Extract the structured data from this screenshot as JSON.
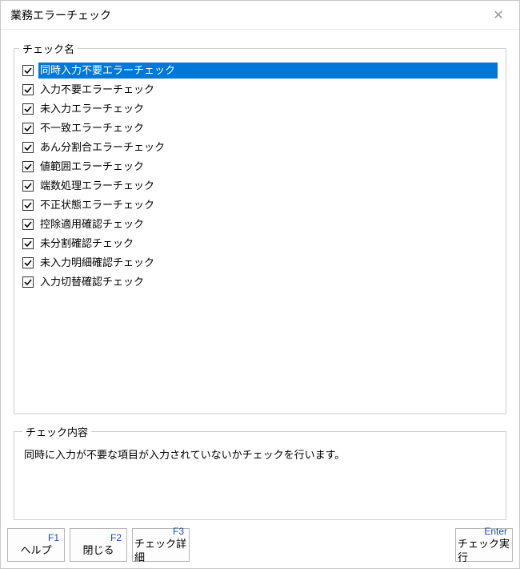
{
  "window": {
    "title": "業務エラーチェック",
    "closeGlyph": "✕"
  },
  "listLegend": "チェック名",
  "items": [
    {
      "label": "同時入力不要エラーチェック",
      "checked": true,
      "selected": true
    },
    {
      "label": "入力不要エラーチェック",
      "checked": true,
      "selected": false
    },
    {
      "label": "未入力エラーチェック",
      "checked": true,
      "selected": false
    },
    {
      "label": "不一致エラーチェック",
      "checked": true,
      "selected": false
    },
    {
      "label": "あん分割合エラーチェック",
      "checked": true,
      "selected": false
    },
    {
      "label": "値範囲エラーチェック",
      "checked": true,
      "selected": false
    },
    {
      "label": "端数処理エラーチェック",
      "checked": true,
      "selected": false
    },
    {
      "label": "不正状態エラーチェック",
      "checked": true,
      "selected": false
    },
    {
      "label": "控除適用確認チェック",
      "checked": true,
      "selected": false
    },
    {
      "label": "未分割確認チェック",
      "checked": true,
      "selected": false
    },
    {
      "label": "未入力明細確認チェック",
      "checked": true,
      "selected": false
    },
    {
      "label": "入力切替確認チェック",
      "checked": true,
      "selected": false
    }
  ],
  "descriptionLegend": "チェック内容",
  "descriptionText": "同時に入力が不要な項目が入力されていないかチェックを行います。",
  "buttons": {
    "help": {
      "key": "F1",
      "label": "ヘルプ"
    },
    "close": {
      "key": "F2",
      "label": "閉じる"
    },
    "detail": {
      "key": "F3",
      "label": "チェック詳細"
    },
    "run": {
      "key": "Enter",
      "label": "チェック実行"
    }
  }
}
